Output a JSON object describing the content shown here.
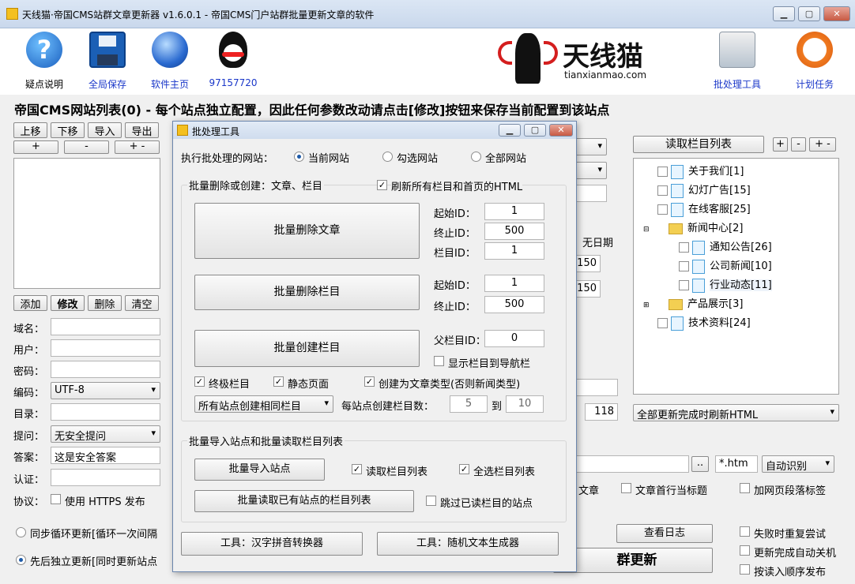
{
  "window": {
    "title": "天线猫·帝国CMS站群文章更新器 v1.6.0.1 - 帝国CMS门户站群批量更新文章的软件"
  },
  "toolbar": {
    "help": "疑点说明",
    "save": "全局保存",
    "home": "软件主页",
    "qq": "97157720",
    "batch": "批处理工具",
    "schedule": "计划任务",
    "logo_text": "天线猫",
    "logo_url": "tianxianmao.com"
  },
  "heading": "帝国CMS网站列表(0) - 每个站点独立配置，因此任何参数改动请点击[修改]按钮来保存当前配置到该站点",
  "left": {
    "up": "上移",
    "down": "下移",
    "import": "导入",
    "export": "导出",
    "plus": "+",
    "minus": "-",
    "plusminus": "+ -",
    "add": "添加",
    "modify": "修改",
    "delete": "删除",
    "clear": "清空",
    "domain_label": "域名：",
    "user_label": "用户：",
    "pwd_label": "密码：",
    "encoding_label": "编码：",
    "encoding_value": "UTF-8",
    "dir_label": "目录：",
    "q_label": "提问：",
    "q_value": "无安全提问",
    "a_label": "答案：",
    "a_value": "这是安全答案",
    "auth_label": "认证：",
    "proto_label": "协议：",
    "https_label": "使用 HTTPS 发布",
    "sync_label": "同步循环更新[循环一次间隔",
    "seq_label": "先后独立更新[同时更新站点"
  },
  "middle": {
    "no_date": "无日期",
    "v1": "150",
    "v2": "150",
    "v3": "118",
    "ext": "*.htm",
    "browse": "..",
    "auto": "自动识别",
    "article": "文章",
    "big_update": "群更新"
  },
  "right": {
    "read_btn": "读取栏目列表",
    "plus": "+",
    "minus": "-",
    "plusminus": "+ -",
    "tree": [
      {
        "label": "关于我们[1]",
        "level": 0,
        "type": "file"
      },
      {
        "label": "幻灯广告[15]",
        "level": 0,
        "type": "file"
      },
      {
        "label": "在线客服[25]",
        "level": 0,
        "type": "file"
      },
      {
        "label": "新闻中心[2]",
        "level": 0,
        "type": "folder"
      },
      {
        "label": "通知公告[26]",
        "level": 1,
        "type": "file"
      },
      {
        "label": "公司新闻[10]",
        "level": 1,
        "type": "file"
      },
      {
        "label": "行业动态[11]",
        "level": 1,
        "type": "file"
      },
      {
        "label": "产品展示[3]",
        "level": 0,
        "type": "folder"
      },
      {
        "label": "技术资料[24]",
        "level": 0,
        "type": "file"
      }
    ],
    "refresh_select": "全部更新完成时刷新HTML",
    "first_line_title": "文章首行当标题",
    "add_tags": "加网页段落标签",
    "view_log": "查看日志",
    "retry": "失败时重复尝试",
    "auto_shutdown": "更新完成自动关机",
    "seq_publish": "按读入顺序发布"
  },
  "dialog": {
    "title": "批处理工具",
    "target_label": "执行批处理的网站：",
    "radio_current": "当前网站",
    "radio_checked": "勾选网站",
    "radio_all": "全部网站",
    "group1_title": "批量删除或创建：文章、栏目",
    "refresh_all": "刷新所有栏目和首页的HTML",
    "del_article": "批量删除文章",
    "del_column": "批量删除栏目",
    "create_column": "批量创建栏目",
    "start_id_label": "起始ID：",
    "end_id_label": "终止ID：",
    "col_id_label": "栏目ID：",
    "parent_id_label": "父栏目ID：",
    "a_start": "1",
    "a_end": "500",
    "a_col": "1",
    "c_start": "1",
    "c_end": "500",
    "parent_id": "0",
    "show_nav": "显示栏目到导航栏",
    "final_col": "终极栏目",
    "static_page": "静态页面",
    "as_article": "创建为文章类型(否则新闻类型)",
    "same_col": "所有站点创建相同栏目",
    "per_site_label": "每站点创建栏目数：",
    "per_min": "5",
    "to": "到",
    "per_max": "10",
    "group2_title": "批量导入站点和批量读取栏目列表",
    "import_sites": "批量导入站点",
    "read_list": "读取栏目列表",
    "select_all": "全选栏目列表",
    "batch_read": "批量读取已有站点的栏目列表",
    "skip_read": "跳过已读栏目的站点",
    "pinyin": "工具：汉字拼音转换器",
    "random_text": "工具：随机文本生成器"
  }
}
